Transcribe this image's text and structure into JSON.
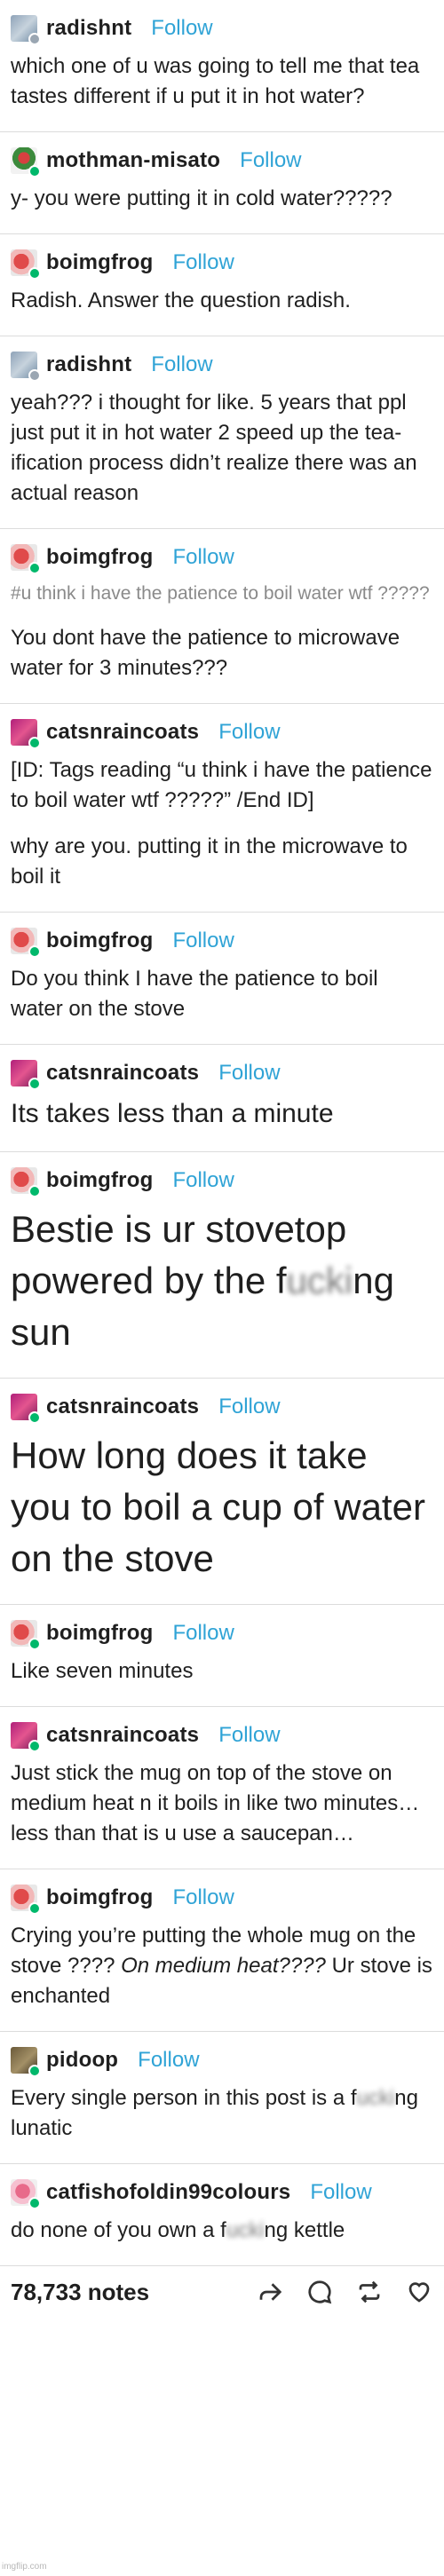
{
  "follow_label": "Follow",
  "posts": [
    {
      "username": "radishnt",
      "avatar": "radish",
      "paragraphs": [
        {
          "style": "",
          "segments": [
            {
              "t": "which one of u was going to tell me that tea tastes different if u put it in hot water?"
            }
          ]
        }
      ]
    },
    {
      "username": "mothman-misato",
      "avatar": "moth",
      "paragraphs": [
        {
          "style": "",
          "segments": [
            {
              "t": "y- you were putting it in cold water?????"
            }
          ]
        }
      ]
    },
    {
      "username": "boimgfrog",
      "avatar": "frog",
      "paragraphs": [
        {
          "style": "",
          "segments": [
            {
              "t": "Radish. Answer the question radish."
            }
          ]
        }
      ]
    },
    {
      "username": "radishnt",
      "avatar": "radish",
      "paragraphs": [
        {
          "style": "",
          "segments": [
            {
              "t": "yeah??? i thought for like. 5 years that ppl just put it in hot water 2 speed up the tea-ification process didn’t realize there was an actual reason"
            }
          ]
        }
      ]
    },
    {
      "username": "boimgfrog",
      "avatar": "frog",
      "paragraphs": [
        {
          "style": "tags",
          "segments": [
            {
              "t": "#u think i have the patience to boil water wtf ?????"
            }
          ]
        },
        {
          "style": "",
          "segments": [
            {
              "t": "You dont have the patience to microwave water for 3 minutes???"
            }
          ]
        }
      ]
    },
    {
      "username": "catsnraincoats",
      "avatar": "cats",
      "paragraphs": [
        {
          "style": "",
          "segments": [
            {
              "t": "[ID: Tags reading “u think i have the patience to boil water wtf ?????” /End ID]"
            }
          ]
        },
        {
          "style": "",
          "segments": [
            {
              "t": "why are you. putting it in the microwave to boil it"
            }
          ]
        }
      ]
    },
    {
      "username": "boimgfrog",
      "avatar": "frog",
      "paragraphs": [
        {
          "style": "",
          "segments": [
            {
              "t": "Do you think I have the patience to boil water on the stove"
            }
          ]
        }
      ]
    },
    {
      "username": "catsnraincoats",
      "avatar": "cats",
      "paragraphs": [
        {
          "style": "big",
          "segments": [
            {
              "t": "Its takes less than a minute"
            }
          ]
        }
      ]
    },
    {
      "username": "boimgfrog",
      "avatar": "frog",
      "paragraphs": [
        {
          "style": "huge",
          "segments": [
            {
              "t": "Bestie is ur stovetop powered by the f"
            },
            {
              "t": "ucki",
              "censor": true
            },
            {
              "t": "ng sun"
            }
          ]
        }
      ]
    },
    {
      "username": "catsnraincoats",
      "avatar": "cats",
      "paragraphs": [
        {
          "style": "huge",
          "segments": [
            {
              "t": "How long does it take you to boil a cup of water on the stove"
            }
          ]
        }
      ]
    },
    {
      "username": "boimgfrog",
      "avatar": "frog",
      "paragraphs": [
        {
          "style": "",
          "segments": [
            {
              "t": "Like seven minutes"
            }
          ]
        }
      ]
    },
    {
      "username": "catsnraincoats",
      "avatar": "cats",
      "paragraphs": [
        {
          "style": "",
          "segments": [
            {
              "t": "Just stick the mug on top of the stove on medium heat n it boils in like two minutes… less than that is u use a saucepan…"
            }
          ]
        }
      ]
    },
    {
      "username": "boimgfrog",
      "avatar": "frog",
      "paragraphs": [
        {
          "style": "",
          "segments": [
            {
              "t": "Crying you’re putting the whole mug on the stove ???? "
            },
            {
              "t": "On medium heat????",
              "emph": true
            },
            {
              "t": " Ur stove is enchanted"
            }
          ]
        }
      ]
    },
    {
      "username": "pidoop",
      "avatar": "pidoop",
      "paragraphs": [
        {
          "style": "",
          "segments": [
            {
              "t": "Every single person in this post is a f"
            },
            {
              "t": "ucki",
              "censor": true
            },
            {
              "t": "ng lunatic"
            }
          ]
        }
      ]
    },
    {
      "username": "catfishofoldin99colours",
      "avatar": "catfish",
      "paragraphs": [
        {
          "style": "",
          "segments": [
            {
              "t": "do none of you own a f"
            },
            {
              "t": "ucki",
              "censor": true
            },
            {
              "t": "ng kettle"
            }
          ]
        }
      ]
    }
  ],
  "footer": {
    "notes": "78,733 notes",
    "icons": [
      "share-icon",
      "reply-icon",
      "reblog-icon",
      "like-icon"
    ]
  },
  "watermark": "imgflip.com"
}
